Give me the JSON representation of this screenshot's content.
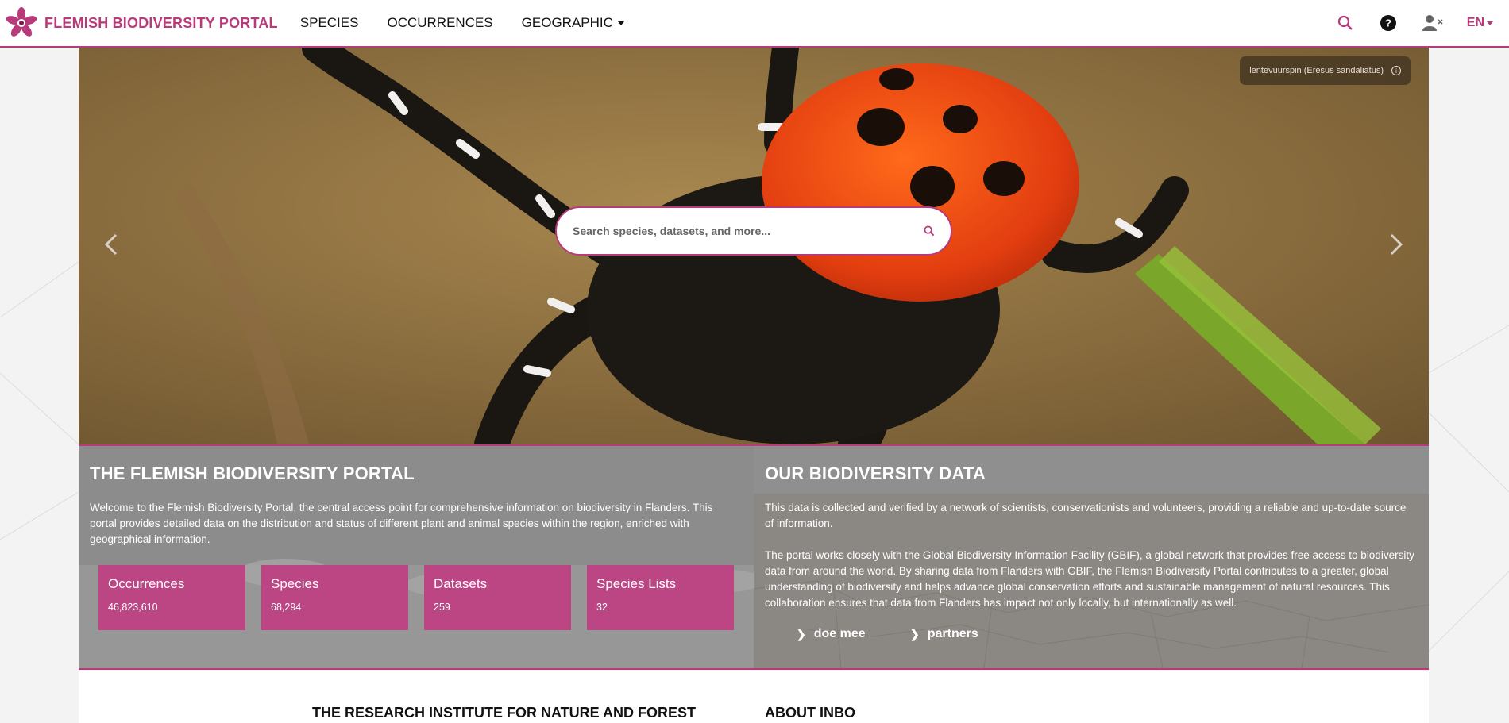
{
  "navbar": {
    "brand": "FLEMISH BIODIVERSITY PORTAL",
    "links": [
      {
        "label": "SPECIES"
      },
      {
        "label": "OCCURRENCES"
      },
      {
        "label": "GEOGRAPHIC"
      }
    ],
    "language": "EN"
  },
  "hero": {
    "photo_caption": "lentevuurspin (Eresus sandaliatus)",
    "search_placeholder": "Search species, datasets, and more..."
  },
  "portal_section": {
    "title": "THE FLEMISH BIODIVERSITY PORTAL",
    "paragraph": "Welcome to the Flemish Biodiversity Portal, the central access point for comprehensive information on biodiversity in Flanders. This portal provides detailed data on the distribution and status of different plant and animal species within the region, enriched with geographical information.",
    "stats": [
      {
        "label": "Occurrences",
        "value": "46,823,610"
      },
      {
        "label": "Species",
        "value": "68,294"
      },
      {
        "label": "Datasets",
        "value": "259"
      },
      {
        "label": "Species Lists",
        "value": "32"
      }
    ]
  },
  "data_section": {
    "title": "OUR BIODIVERSITY DATA",
    "paragraph1": "This data is collected and verified by a network of scientists, conservationists and volunteers, providing a reliable and up-to-date source of information.",
    "paragraph2": "The portal works closely with the Global Biodiversity Information Facility (GBIF), a global network that provides free access to biodiversity data from around the world. By sharing data from Flanders with GBIF, the Flemish Biodiversity Portal contributes to a greater, global understanding of biodiversity and helps advance global conservation efforts and sustainable management of natural resources. This collaboration ensures that data from Flanders has impact not only locally, but internationally as well.",
    "links": [
      {
        "label": "doe mee"
      },
      {
        "label": "partners"
      }
    ]
  },
  "bottom": {
    "left_heading": "THE RESEARCH INSTITUTE FOR NATURE AND FOREST",
    "right_heading": "ABOUT INBO"
  },
  "colors": {
    "accent": "#b83a7a",
    "card": "#bc4584"
  },
  "icons": [
    "flower-logo-icon",
    "caret-down-icon",
    "search-icon",
    "help-icon",
    "user-x-icon",
    "info-icon",
    "chevron-left-icon",
    "chevron-right-icon",
    "chevron-link-icon"
  ]
}
